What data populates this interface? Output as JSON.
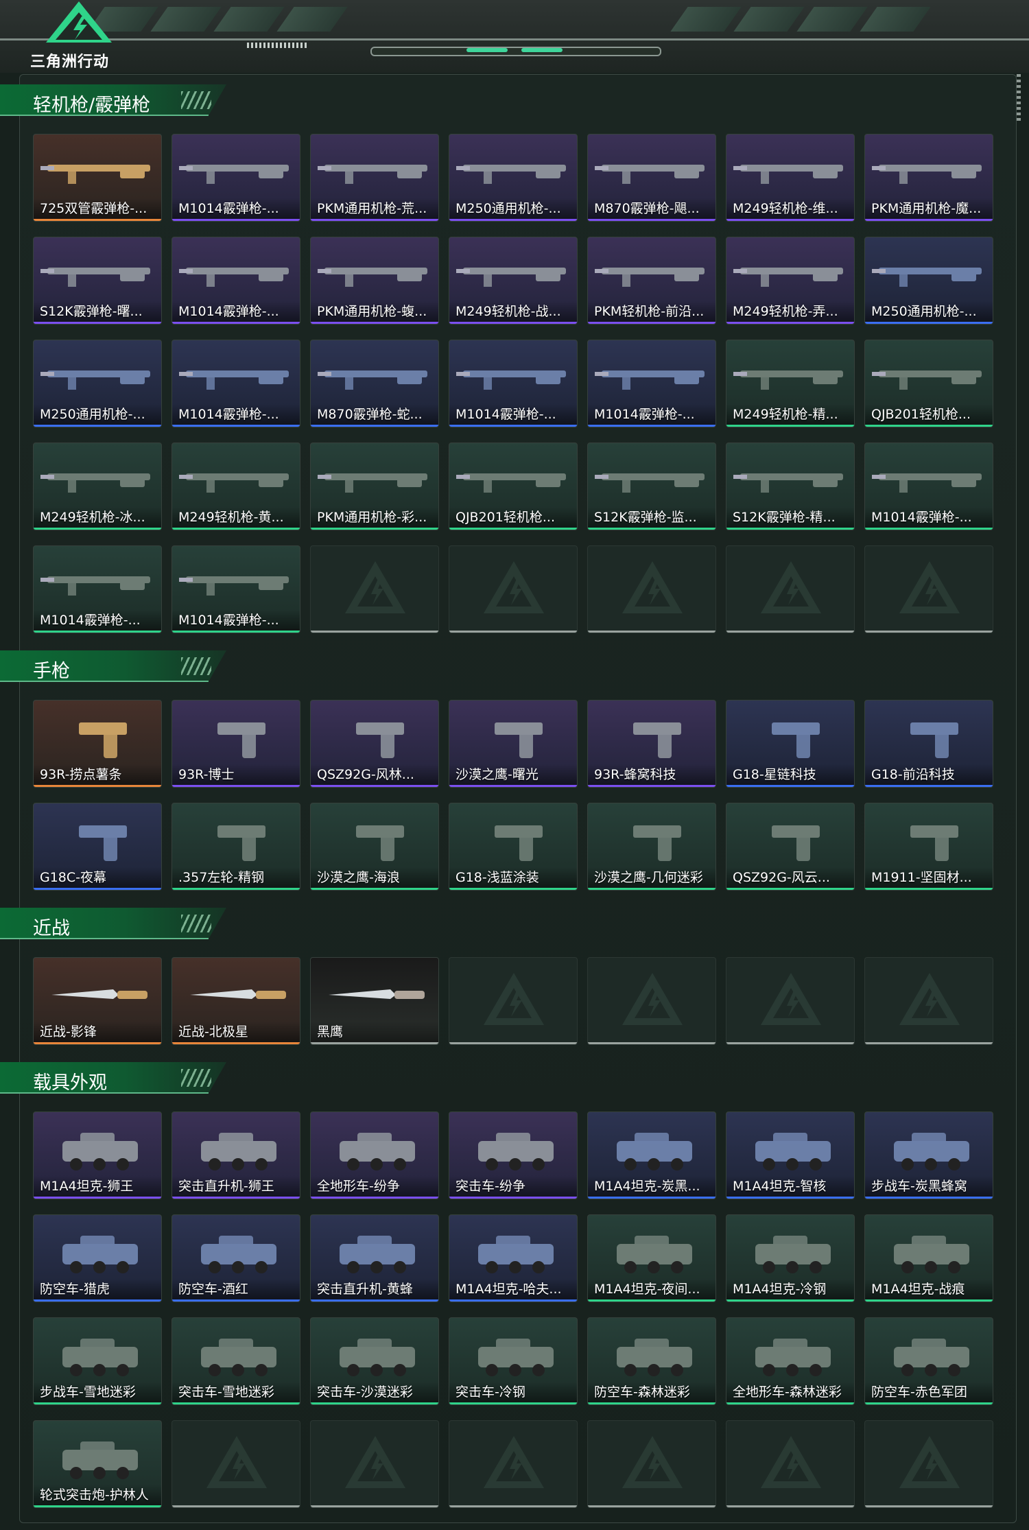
{
  "app": {
    "title": "三角洲行动"
  },
  "colors": {
    "orange": "#e8863a",
    "purple": "#7b4ff0",
    "blue": "#3a6ef2",
    "green": "#2fd48a",
    "accent": "#3fd59b"
  },
  "sections": [
    {
      "title": "轻机枪/霰弹枪",
      "icon": "weapon",
      "items": [
        {
          "label": "725双管霰弹枪-...",
          "rarity": "orange"
        },
        {
          "label": "M1014霰弹枪-...",
          "rarity": "purple"
        },
        {
          "label": "PKM通用机枪-荒...",
          "rarity": "purple"
        },
        {
          "label": "M250通用机枪-...",
          "rarity": "purple"
        },
        {
          "label": "M870霰弹枪-飓...",
          "rarity": "purple"
        },
        {
          "label": "M249轻机枪-维...",
          "rarity": "purple"
        },
        {
          "label": "PKM通用机枪-魔...",
          "rarity": "purple"
        },
        {
          "label": "S12K霰弹枪-曙...",
          "rarity": "purple"
        },
        {
          "label": "M1014霰弹枪-...",
          "rarity": "purple"
        },
        {
          "label": "PKM通用机枪-蝮...",
          "rarity": "purple"
        },
        {
          "label": "M249轻机枪-战...",
          "rarity": "purple"
        },
        {
          "label": "PKM轻机枪-前沿...",
          "rarity": "purple"
        },
        {
          "label": "M249轻机枪-弄...",
          "rarity": "purple"
        },
        {
          "label": "M250通用机枪-...",
          "rarity": "blue"
        },
        {
          "label": "M250通用机枪-...",
          "rarity": "blue"
        },
        {
          "label": "M1014霰弹枪-...",
          "rarity": "blue"
        },
        {
          "label": "M870霰弹枪-蛇...",
          "rarity": "blue"
        },
        {
          "label": "M1014霰弹枪-...",
          "rarity": "blue"
        },
        {
          "label": "M1014霰弹枪-...",
          "rarity": "blue"
        },
        {
          "label": "M249轻机枪-精...",
          "rarity": "green"
        },
        {
          "label": "QJB201轻机枪...",
          "rarity": "green"
        },
        {
          "label": "M249轻机枪-冰...",
          "rarity": "green"
        },
        {
          "label": "M249轻机枪-黄...",
          "rarity": "green"
        },
        {
          "label": "PKM通用机枪-彩...",
          "rarity": "green"
        },
        {
          "label": "QJB201轻机枪...",
          "rarity": "green"
        },
        {
          "label": "S12K霰弹枪-监...",
          "rarity": "green"
        },
        {
          "label": "S12K霰弹枪-精...",
          "rarity": "green"
        },
        {
          "label": "M1014霰弹枪-...",
          "rarity": "green"
        },
        {
          "label": "M1014霰弹枪-...",
          "rarity": "green"
        },
        {
          "label": "M1014霰弹枪-...",
          "rarity": "green"
        }
      ]
    },
    {
      "title": "手枪",
      "icon": "pistol",
      "items": [
        {
          "label": "93R-捞点薯条",
          "rarity": "orange"
        },
        {
          "label": "93R-博士",
          "rarity": "purple"
        },
        {
          "label": "QSZ92G-风林...",
          "rarity": "purple"
        },
        {
          "label": "沙漠之鹰-曙光",
          "rarity": "purple"
        },
        {
          "label": "93R-蜂窝科技",
          "rarity": "purple"
        },
        {
          "label": "G18-星链科技",
          "rarity": "blue"
        },
        {
          "label": "G18-前沿科技",
          "rarity": "blue"
        },
        {
          "label": "G18C-夜幕",
          "rarity": "blue"
        },
        {
          "label": ".357左轮-精钢",
          "rarity": "green"
        },
        {
          "label": "沙漠之鹰-海浪",
          "rarity": "green"
        },
        {
          "label": "G18-浅蓝涂装",
          "rarity": "green"
        },
        {
          "label": "沙漠之鹰-几何迷彩",
          "rarity": "green"
        },
        {
          "label": "QSZ92G-风云...",
          "rarity": "green"
        },
        {
          "label": "M1911-坚固材...",
          "rarity": "green"
        }
      ]
    },
    {
      "title": "近战",
      "icon": "knife",
      "items": [
        {
          "label": "近战-影锋",
          "rarity": "orange"
        },
        {
          "label": "近战-北极星",
          "rarity": "orange"
        },
        {
          "label": "黑鹰",
          "rarity": "none"
        }
      ]
    },
    {
      "title": "载具外观",
      "icon": "vehicle",
      "items": [
        {
          "label": "M1A4坦克-狮王",
          "rarity": "purple"
        },
        {
          "label": "突击直升机-狮王",
          "rarity": "purple"
        },
        {
          "label": "全地形车-纷争",
          "rarity": "purple"
        },
        {
          "label": "突击车-纷争",
          "rarity": "purple"
        },
        {
          "label": "M1A4坦克-炭黑...",
          "rarity": "blue"
        },
        {
          "label": "M1A4坦克-智核",
          "rarity": "blue"
        },
        {
          "label": "步战车-炭黑蜂窝",
          "rarity": "blue"
        },
        {
          "label": "防空车-猎虎",
          "rarity": "blue"
        },
        {
          "label": "防空车-酒红",
          "rarity": "blue"
        },
        {
          "label": "突击直升机-黄蜂",
          "rarity": "blue"
        },
        {
          "label": "M1A4坦克-哈夫...",
          "rarity": "blue"
        },
        {
          "label": "M1A4坦克-夜间...",
          "rarity": "green"
        },
        {
          "label": "M1A4坦克-冷钢",
          "rarity": "green"
        },
        {
          "label": "M1A4坦克-战痕",
          "rarity": "green"
        },
        {
          "label": "步战车-雪地迷彩",
          "rarity": "green"
        },
        {
          "label": "突击车-雪地迷彩",
          "rarity": "green"
        },
        {
          "label": "突击车-沙漠迷彩",
          "rarity": "green"
        },
        {
          "label": "突击车-冷钢",
          "rarity": "green"
        },
        {
          "label": "防空车-森林迷彩",
          "rarity": "green"
        },
        {
          "label": "全地形车-森林迷彩",
          "rarity": "green"
        },
        {
          "label": "防空车-赤色军团",
          "rarity": "green"
        },
        {
          "label": "轮式突击炮-护林人",
          "rarity": "green"
        }
      ]
    }
  ]
}
